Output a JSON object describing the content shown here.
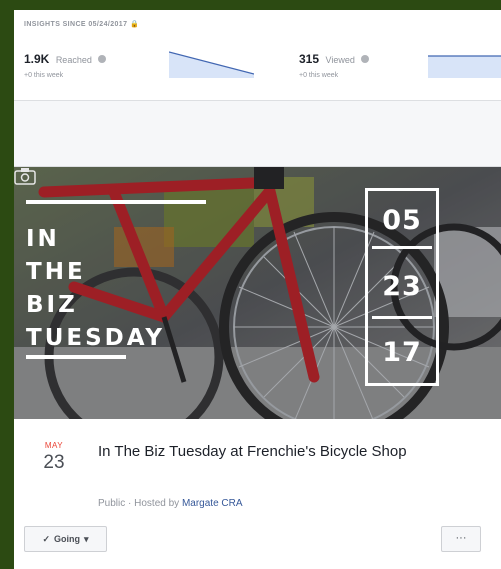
{
  "insights": {
    "title": "INSIGHTS SINCE 05/24/2017",
    "stats": [
      {
        "value": "1.9K",
        "label": "Reached",
        "sub": "+0 this week"
      },
      {
        "value": "315",
        "label": "Viewed",
        "sub": "+0 this week"
      }
    ]
  },
  "cover": {
    "lines": [
      "IN",
      "THE",
      "BIZ",
      "TUESDAY"
    ],
    "date_digits": [
      "05",
      "23",
      "17"
    ]
  },
  "event": {
    "month": "MAY",
    "day": "23",
    "title": "In The Biz Tuesday at Frenchie's Bicycle Shop",
    "privacy": "Public",
    "hosted_by_prefix": " · Hosted by ",
    "host": "Margate CRA"
  },
  "actions": {
    "going_label": "Going",
    "more_label": "···"
  },
  "icons": {
    "lock": "lock-icon",
    "info": "info-icon",
    "check": "check-icon",
    "caret": "caret-down-icon",
    "camera": "camera-icon"
  },
  "colors": {
    "accent": "#365899",
    "month": "#ea4335",
    "bike_red": "#c0262e",
    "outer_border": "#2c4a12"
  }
}
